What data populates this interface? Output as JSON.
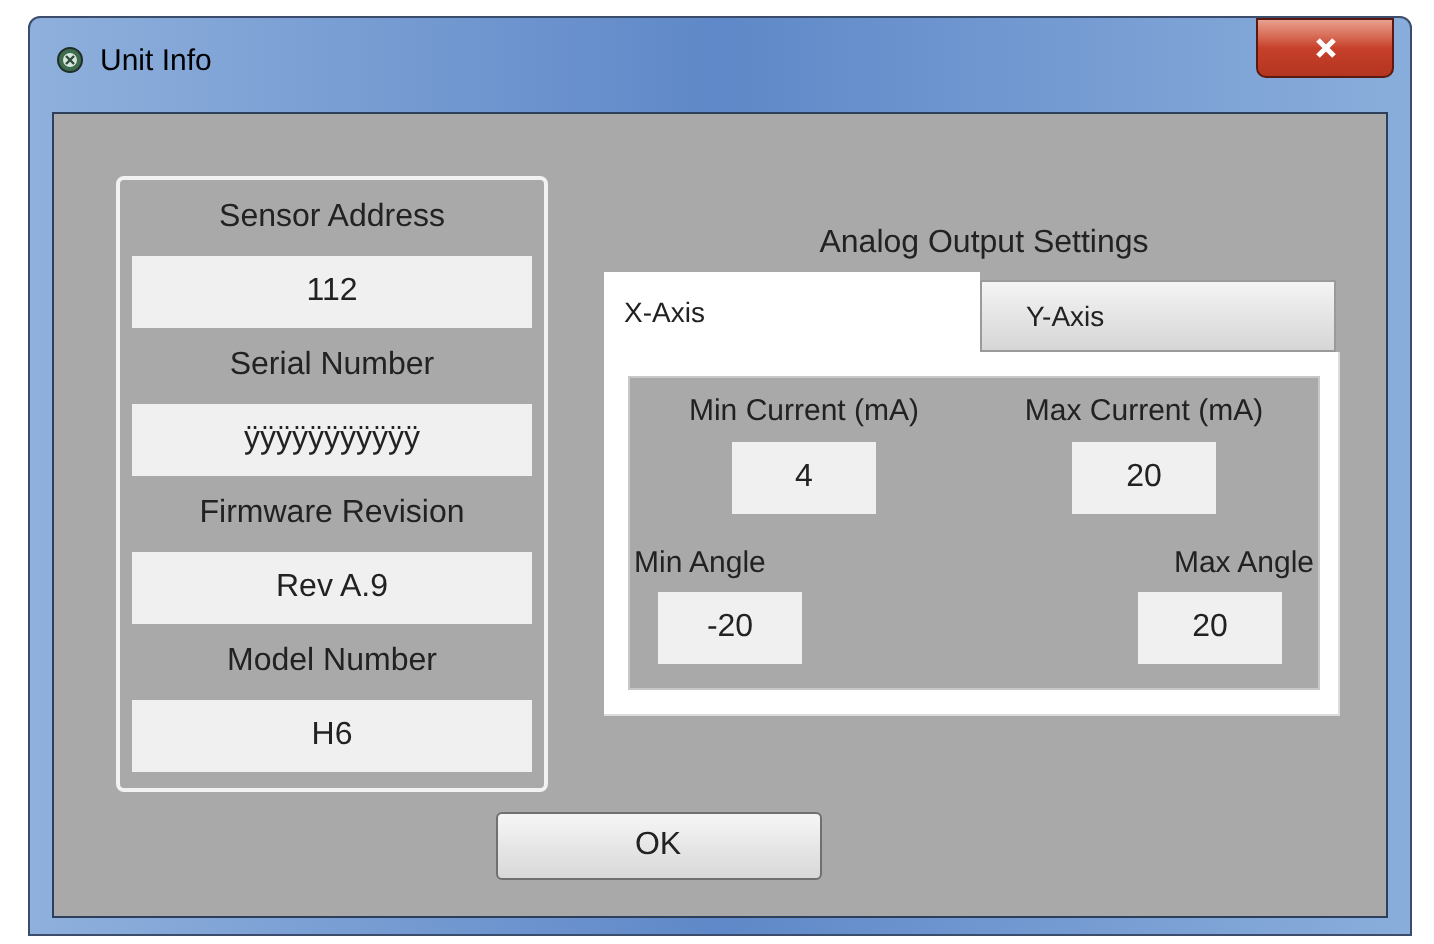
{
  "window": {
    "title": "Unit Info"
  },
  "unit_fields": [
    {
      "label": "Sensor Address",
      "value": "112"
    },
    {
      "label": "Serial Number",
      "value": "ÿÿÿÿÿÿÿÿÿÿÿ"
    },
    {
      "label": "Firmware Revision",
      "value": "Rev A.9"
    },
    {
      "label": "Model Number",
      "value": "H6"
    }
  ],
  "analog_output": {
    "title": "Analog Output Settings",
    "tabs": [
      {
        "label": "X-Axis",
        "selected": true
      },
      {
        "label": "Y-Axis",
        "selected": false
      }
    ],
    "fields": [
      {
        "label": "Min Current (mA)",
        "value": "4"
      },
      {
        "label": "Max Current (mA)",
        "value": "20"
      },
      {
        "label": "Min Angle",
        "value": "-20"
      },
      {
        "label": "Max Angle",
        "value": "20"
      }
    ]
  },
  "buttons": [
    "OK"
  ]
}
